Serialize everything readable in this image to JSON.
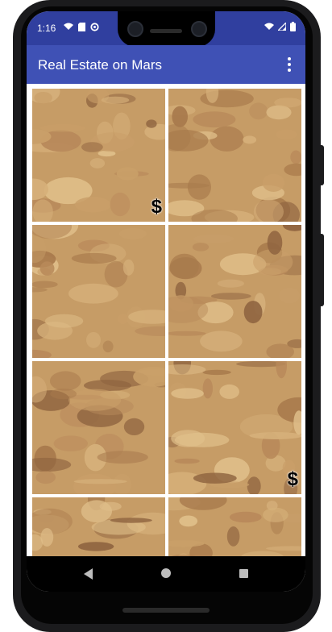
{
  "status_bar": {
    "time": "1:16",
    "left_icons": [
      "wifi-icon",
      "sd-card-icon",
      "sync-icon"
    ],
    "right_icons": [
      "wifi-signal-icon",
      "cell-signal-icon",
      "battery-icon"
    ]
  },
  "app_bar": {
    "title": "Real Estate on Mars",
    "menu_icon": "more-vert-icon"
  },
  "grid": {
    "tiles": [
      {
        "label": "",
        "for_sale": true
      },
      {
        "label": "",
        "for_sale": false
      },
      {
        "label": "",
        "for_sale": false
      },
      {
        "label": "",
        "for_sale": false
      },
      {
        "label": "",
        "for_sale": false
      },
      {
        "label": "",
        "for_sale": true
      },
      {
        "label": "",
        "for_sale": false
      },
      {
        "label": "",
        "for_sale": false
      }
    ],
    "sale_symbol": "$"
  },
  "nav_bar": {
    "icons": [
      "back-icon",
      "home-icon",
      "recents-icon"
    ]
  },
  "colors": {
    "status_bar": "#303f9f",
    "app_bar": "#3f51b5",
    "mars_sand": "#c69c66"
  }
}
